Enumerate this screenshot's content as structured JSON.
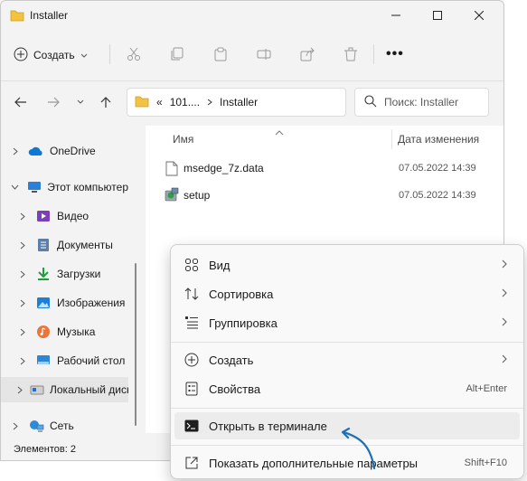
{
  "window": {
    "title": "Installer"
  },
  "toolbar": {
    "create_label": "Создать",
    "more_label": "•••"
  },
  "address": {
    "prefix": "«",
    "crumb1": "101....",
    "crumb2": "Installer"
  },
  "search": {
    "placeholder": "Поиск: Installer"
  },
  "sidebar": {
    "items": [
      {
        "label": "OneDrive"
      },
      {
        "label": "Этот компьютер"
      },
      {
        "label": "Видео"
      },
      {
        "label": "Документы"
      },
      {
        "label": "Загрузки"
      },
      {
        "label": "Изображения"
      },
      {
        "label": "Музыка"
      },
      {
        "label": "Рабочий стол"
      },
      {
        "label": "Локальный диск"
      },
      {
        "label": "Сеть"
      }
    ]
  },
  "columns": {
    "name": "Имя",
    "date": "Дата изменения"
  },
  "files": [
    {
      "name": "msedge_7z.data",
      "date": "07.05.2022 14:39"
    },
    {
      "name": "setup",
      "date": "07.05.2022 14:39"
    }
  ],
  "status": {
    "items_count": "Элементов: 2"
  },
  "context_menu": {
    "view": "Вид",
    "sort": "Сортировка",
    "group": "Группировка",
    "create": "Создать",
    "properties": "Свойства",
    "properties_shortcut": "Alt+Enter",
    "open_terminal": "Открыть в терминале",
    "more_options": "Показать дополнительные параметры",
    "more_options_shortcut": "Shift+F10"
  },
  "colors": {
    "accent": "#0067c0",
    "folder": "#f0c342",
    "callout": "#1f6fb5"
  }
}
